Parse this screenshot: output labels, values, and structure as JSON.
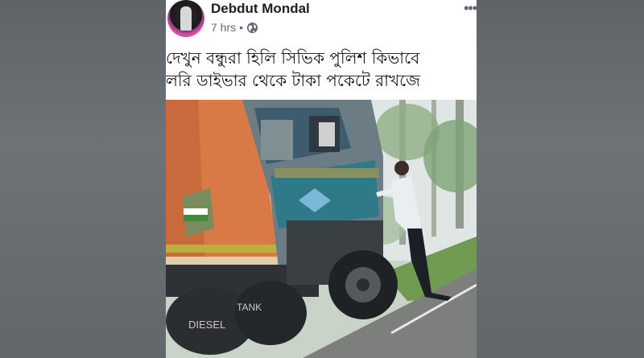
{
  "post": {
    "author": "Debdut Mondal",
    "time": "7 hrs",
    "separator": "•",
    "text_line1": "দেখুন বন্ধুরা হিলি সিভিক পুলিশ কিভাবে",
    "text_line2": "লরি ডাইভার থেকে  টাকা পকেটে রাখজে",
    "icons": [
      "avatar",
      "globe-icon",
      "more-icon"
    ]
  },
  "photo": {
    "truck_text": "DIESEL",
    "tank_text": "TANK"
  },
  "colors": {
    "author": "#1c1e21",
    "meta": "#606770",
    "background": "#6e7378"
  }
}
